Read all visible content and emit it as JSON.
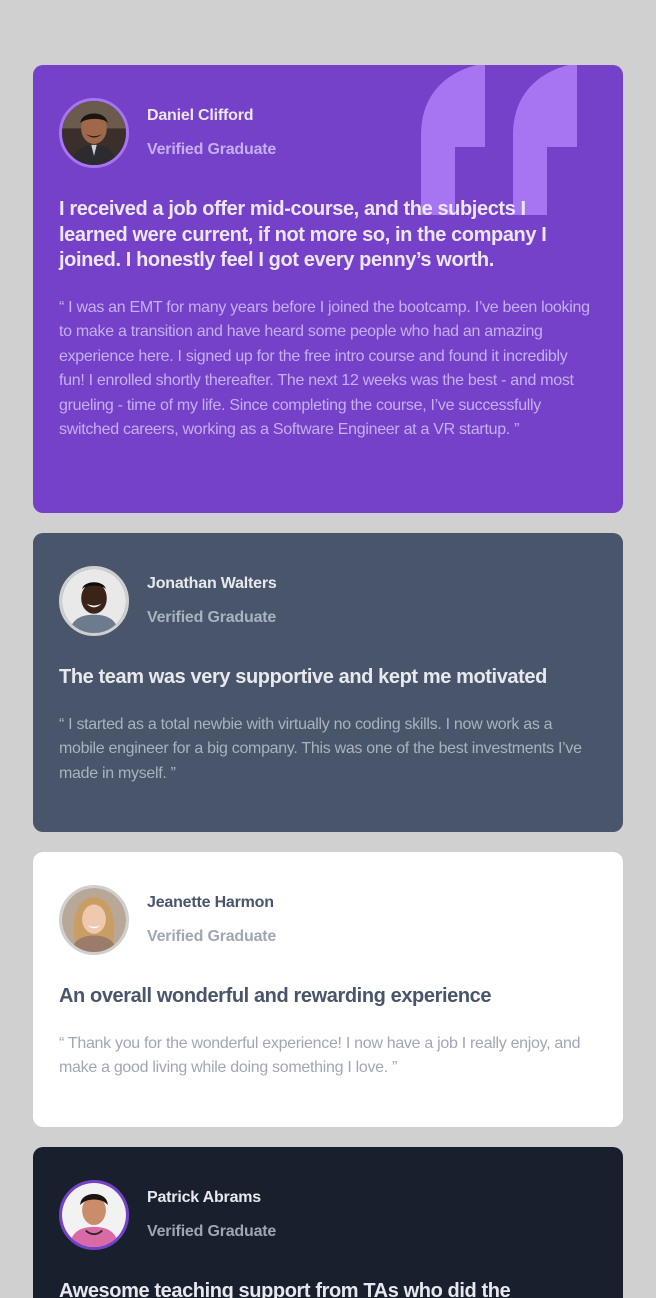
{
  "colors": {
    "background": "#d0d0d0",
    "purple": "#7541c8",
    "grayish_blue": "#48556a",
    "white": "#ffffff",
    "dark_blackish_blue": "#19202d",
    "quote_mark": "#a775f1"
  },
  "testimonials": [
    {
      "name": "Daniel Clifford",
      "role": "Verified Graduate",
      "headline": "I received a job offer mid-course, and the subjects I learned were current, if not more so, in the company I joined. I honestly feel I got every penny’s worth.",
      "body": "“ I was an EMT for many years before I joined the bootcamp. I’ve been looking to make a transition and have heard some people who had an amazing experience here. I signed up for the free intro course and found it incredibly fun! I enrolled shortly thereafter. The next 12 weeks was the best - and most grueling - time of my life. Since completing the course, I’ve successfully switched careers, working as a Software Engineer at a VR startup. ”",
      "avatar_icon": "avatar-photo"
    },
    {
      "name": "Jonathan Walters",
      "role": "Verified Graduate",
      "headline": "The team was very supportive and kept me motivated",
      "body": "“ I started as a total newbie with virtually no coding skills. I now work as a mobile engineer for a big company. This was one of the best investments I’ve made in myself. ”",
      "avatar_icon": "avatar-photo"
    },
    {
      "name": "Jeanette Harmon",
      "role": "Verified Graduate",
      "headline": "An overall wonderful and rewarding experience",
      "body": "“ Thank you for the wonderful experience! I now have a job I really enjoy, and make a good living while doing something I love. ”",
      "avatar_icon": "avatar-photo"
    },
    {
      "name": "Patrick Abrams",
      "role": "Verified Graduate",
      "headline": "Awesome teaching support from TAs who did the bootcamp",
      "body": "",
      "avatar_icon": "avatar-photo"
    }
  ]
}
